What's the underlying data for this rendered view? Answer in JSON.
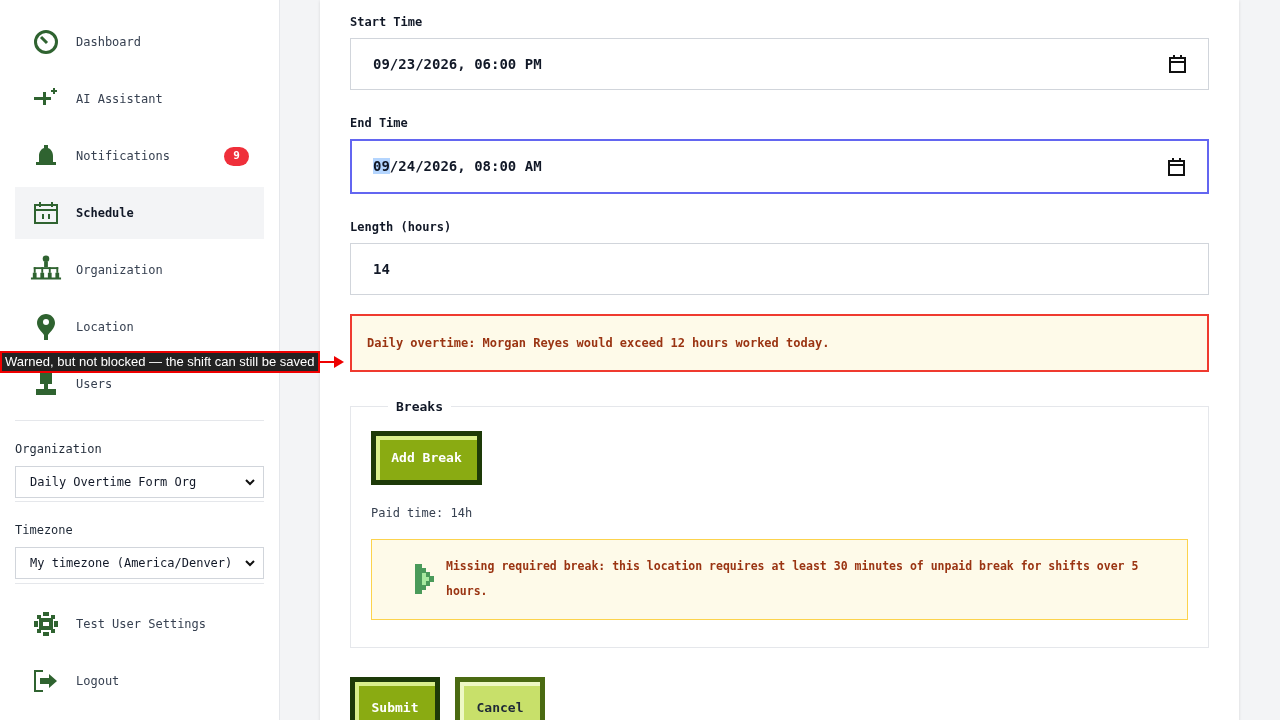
{
  "sidebar": {
    "nav": [
      {
        "label": "Dashboard",
        "selected": false
      },
      {
        "label": "AI Assistant",
        "selected": false
      },
      {
        "label": "Notifications",
        "selected": false,
        "badge": "9"
      },
      {
        "label": "Schedule",
        "selected": true
      },
      {
        "label": "Organization",
        "selected": false
      },
      {
        "label": "Location",
        "selected": false
      },
      {
        "label": "Users",
        "selected": false
      }
    ],
    "selects": [
      {
        "label": "Organization",
        "value": "Daily Overtime Form Org"
      },
      {
        "label": "Timezone",
        "value": "My timezone (America/Denver)"
      }
    ],
    "footer": [
      {
        "label": "Test User Settings"
      },
      {
        "label": "Logout"
      }
    ]
  },
  "form": {
    "fields": [
      {
        "label": "Start Time",
        "kind": "datetime",
        "value": "09/23/2026, 06:00 PM",
        "focused": false
      },
      {
        "label": "End Time",
        "kind": "datetime",
        "value": "09/24/2026, 08:00 AM",
        "focused": true
      },
      {
        "label": "Length (hours)",
        "kind": "number",
        "value": "14",
        "focused": false
      }
    ],
    "overtime_warning": "Daily overtime: Morgan Reyes would exceed 12 hours worked today.",
    "breaks": {
      "legend": "Breaks",
      "add_button": "Add Break",
      "paid_time": "Paid time: 14h",
      "alert": "Missing required break: this location requires at least 30 minutes of unpaid break for shifts over 5 hours."
    },
    "buttons": [
      {
        "label": "Submit",
        "kind": "primary"
      },
      {
        "label": "Cancel",
        "kind": "secondary"
      }
    ]
  },
  "annotation": {
    "text": "Warned, but not blocked — the shift can still be saved"
  }
}
